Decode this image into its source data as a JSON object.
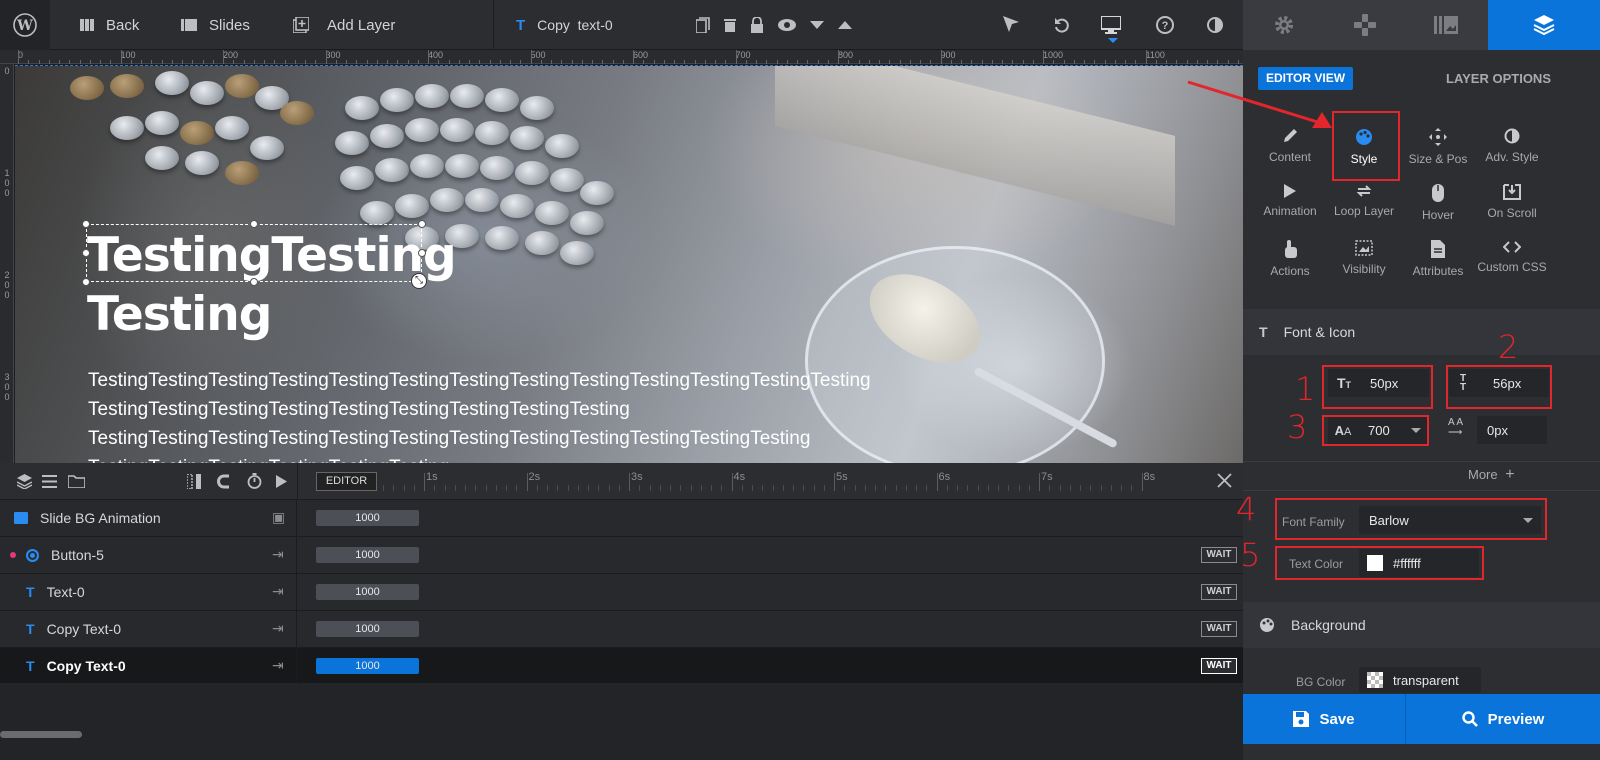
{
  "toolbar": {
    "back": "Back",
    "slides": "Slides",
    "add_layer": "Add Layer",
    "current_layer": "Copy  text-0"
  },
  "ruler": {
    "top": [
      "0",
      "100",
      "200",
      "300",
      "400",
      "500",
      "600",
      "700",
      "800",
      "900",
      "1000",
      "1100"
    ],
    "left": [
      "0",
      "1\n0\n0",
      "2\n0\n0",
      "3\n0\n0"
    ]
  },
  "canvas": {
    "title": "TestingTesting Testing",
    "body": "TestingTestingTestingTestingTestingTestingTestingTestingTestingTestingTestingTestingTesting TestingTestingTestingTestingTestingTestingTestingTestingTesting TestingTestingTestingTestingTestingTestingTestingTestingTestingTestingTestingTesting TestingTestingTestingTestingTestingTesting"
  },
  "timeline": {
    "editor_label": "EDITOR",
    "ticks": [
      "1s",
      "2s",
      "3s",
      "4s",
      "5s",
      "6s",
      "7s",
      "8s"
    ],
    "rows": [
      {
        "name": "Slide BG Animation",
        "value": "1000",
        "wait": ""
      },
      {
        "name": "Button-5",
        "value": "1000",
        "wait": "WAIT"
      },
      {
        "name": "Text-0",
        "value": "1000",
        "wait": "WAIT"
      },
      {
        "name": "Copy Text-0",
        "value": "1000",
        "wait": "WAIT"
      },
      {
        "name": "Copy Text-0",
        "value": "1000",
        "wait": "WAIT"
      }
    ]
  },
  "panel": {
    "editor_view": "EDITOR VIEW",
    "layer_options": "LAYER OPTIONS",
    "grid": [
      "Content",
      "Style",
      "Size & Pos",
      "Adv. Style",
      "Animation",
      "Loop Layer",
      "Hover",
      "On Scroll",
      "Actions",
      "Visibility",
      "Attributes",
      "Custom CSS"
    ],
    "font_section": "Font & Icon",
    "font_size": "50px",
    "line_height": "56px",
    "font_weight": "700",
    "letter_spacing": "0px",
    "more": "More",
    "font_family_label": "Font Family",
    "font_family": "Barlow",
    "text_color_label": "Text Color",
    "text_color": "#ffffff",
    "bg_section": "Background",
    "bg_color_label": "BG Color",
    "bg_color": "transparent",
    "save": "Save",
    "preview": "Preview"
  },
  "annotations": [
    "1",
    "2",
    "3",
    "4",
    "5"
  ],
  "colors": {
    "accent": "#0a74da",
    "annotation": "#e2262b",
    "panel": "#2d2e32"
  }
}
